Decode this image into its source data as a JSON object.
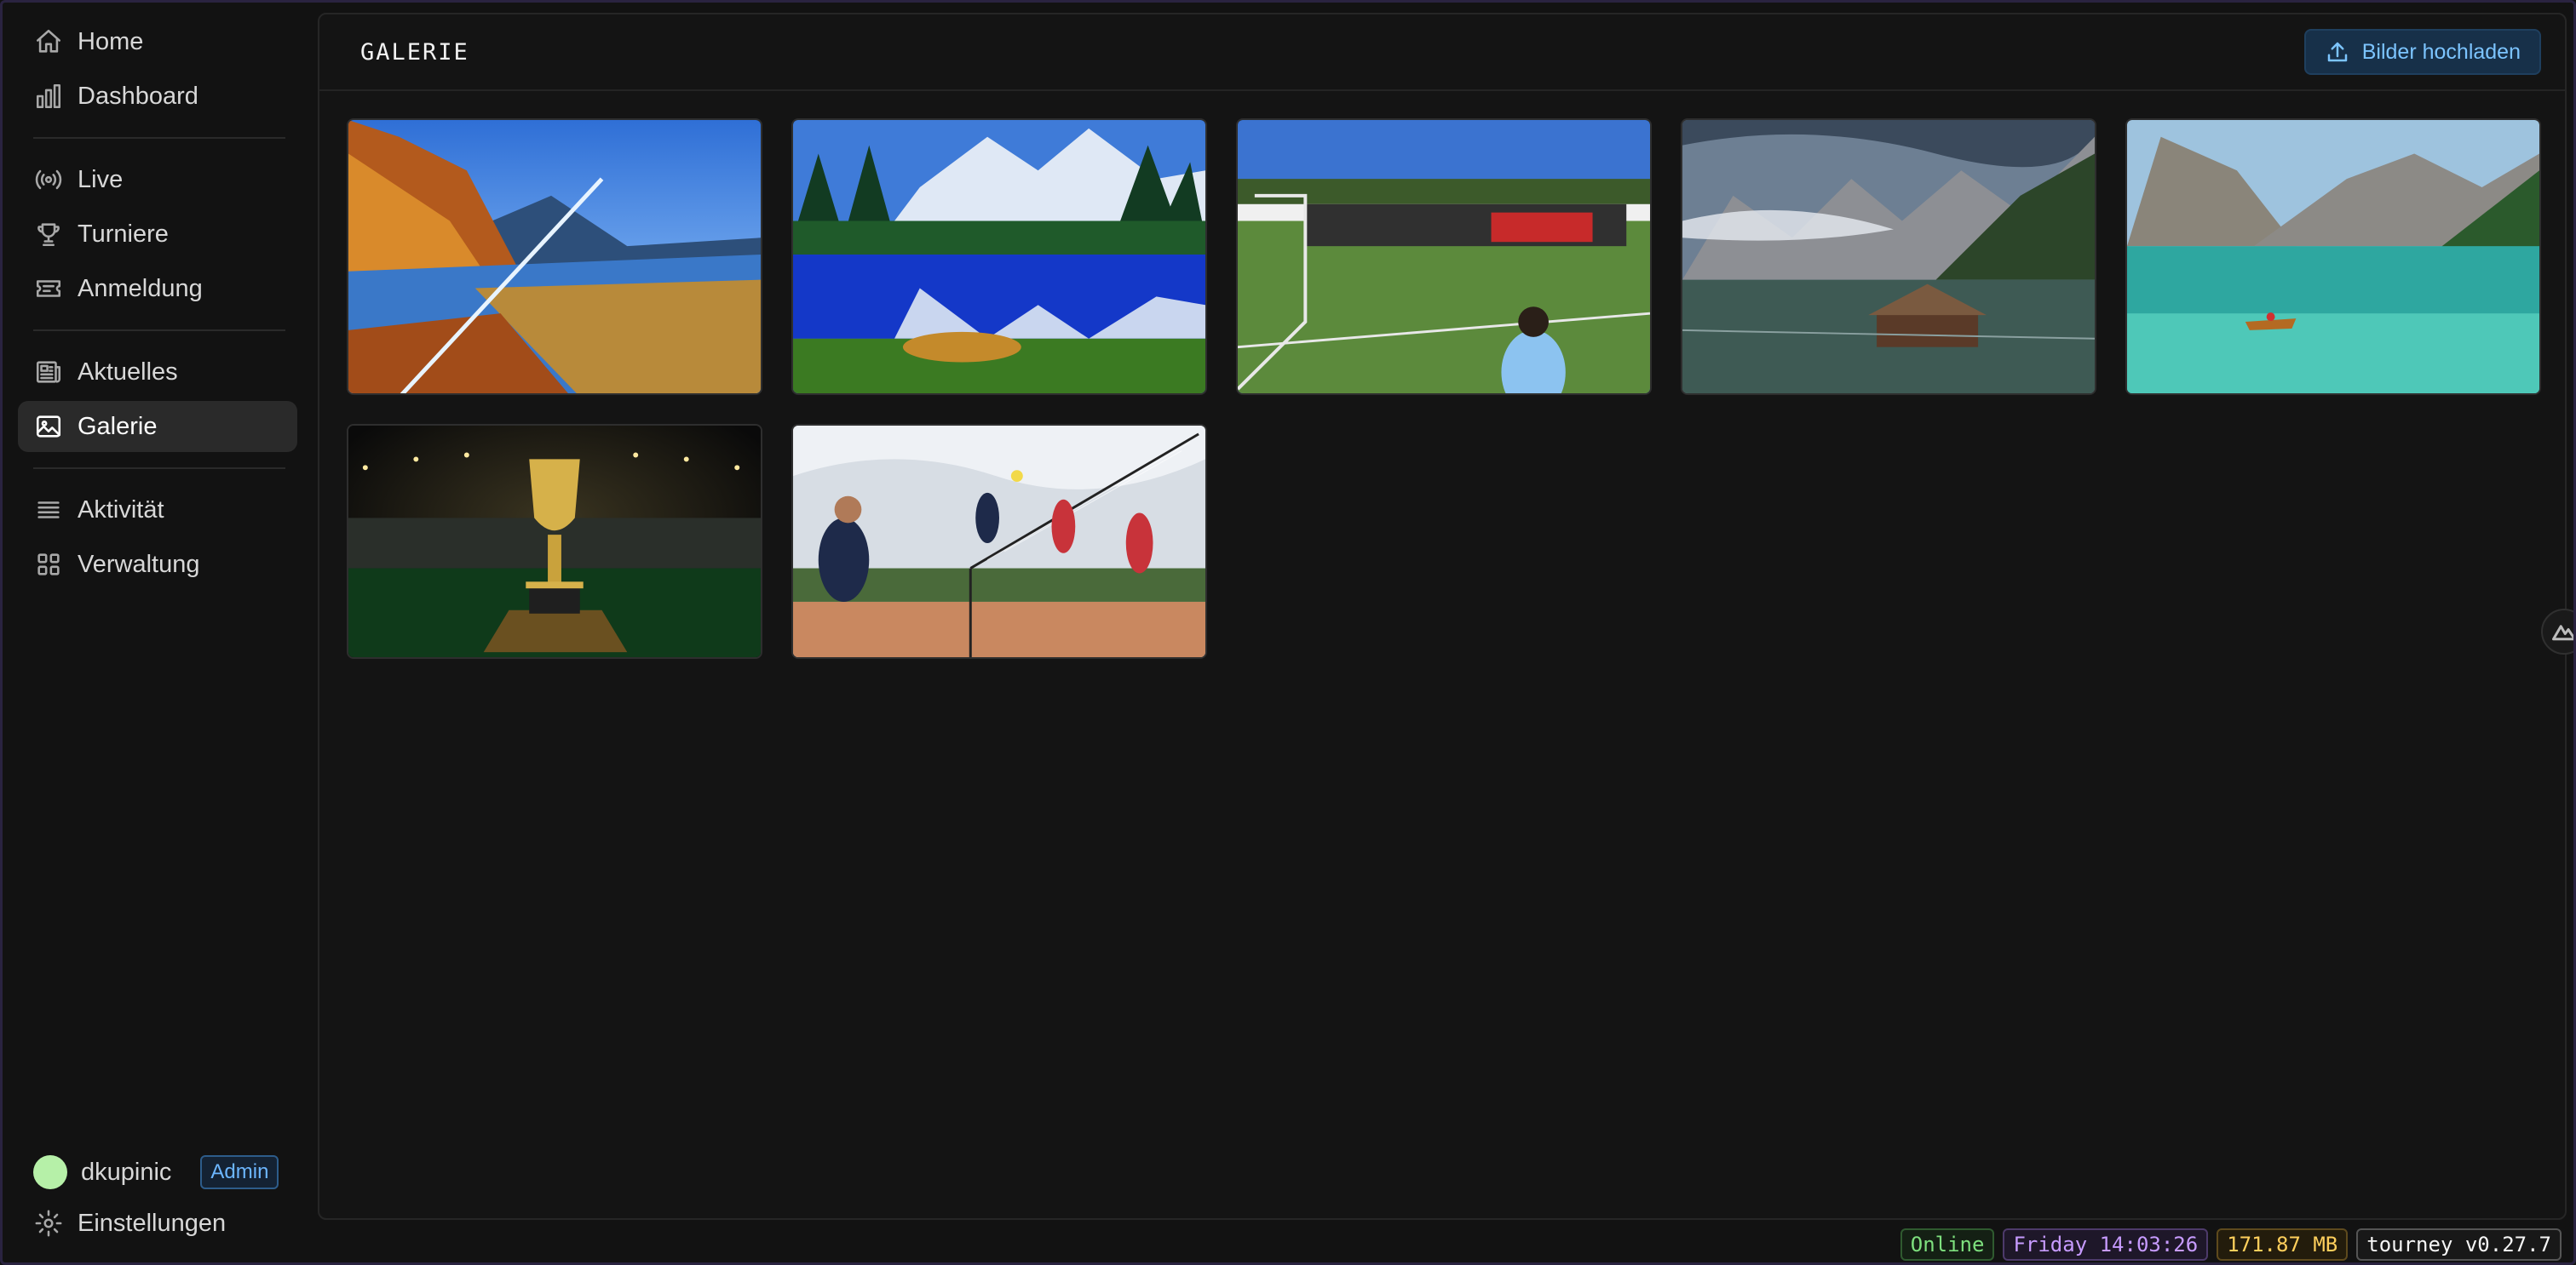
{
  "sidebar": {
    "groups": [
      [
        {
          "label": "Home",
          "icon": "home-icon"
        },
        {
          "label": "Dashboard",
          "icon": "bar-chart-icon"
        }
      ],
      [
        {
          "label": "Live",
          "icon": "broadcast-icon"
        },
        {
          "label": "Turniere",
          "icon": "trophy-icon"
        },
        {
          "label": "Anmeldung",
          "icon": "ticket-icon"
        }
      ],
      [
        {
          "label": "Aktuelles",
          "icon": "newspaper-icon"
        },
        {
          "label": "Galerie",
          "icon": "image-icon",
          "active": true
        }
      ],
      [
        {
          "label": "Aktivität",
          "icon": "list-icon"
        },
        {
          "label": "Verwaltung",
          "icon": "grid-icon"
        }
      ]
    ],
    "user": {
      "name": "dkupinic",
      "role": "Admin"
    },
    "settings_label": "Einstellungen"
  },
  "main": {
    "title": "GALERIE",
    "upload_label": "Bilder hochladen",
    "images": [
      {
        "icon": "landscape-lake-autumn-image"
      },
      {
        "icon": "landscape-mountain-lake-image"
      },
      {
        "icon": "football-team-field-image"
      },
      {
        "icon": "dolomites-lake-hut-image"
      },
      {
        "icon": "turquoise-lake-boat-image"
      },
      {
        "icon": "trophy-stadium-image"
      },
      {
        "icon": "volleyball-game-image"
      }
    ]
  },
  "status": {
    "connection": "Online",
    "datetime": "Friday 14:03:26",
    "memory": "171.87 MB",
    "version": "tourney v0.27.7"
  },
  "colors": {
    "background": "#121212",
    "accent": "#7cc4ff",
    "online": "#7ee07e",
    "time": "#c79bff",
    "memory": "#ffcf5c"
  }
}
